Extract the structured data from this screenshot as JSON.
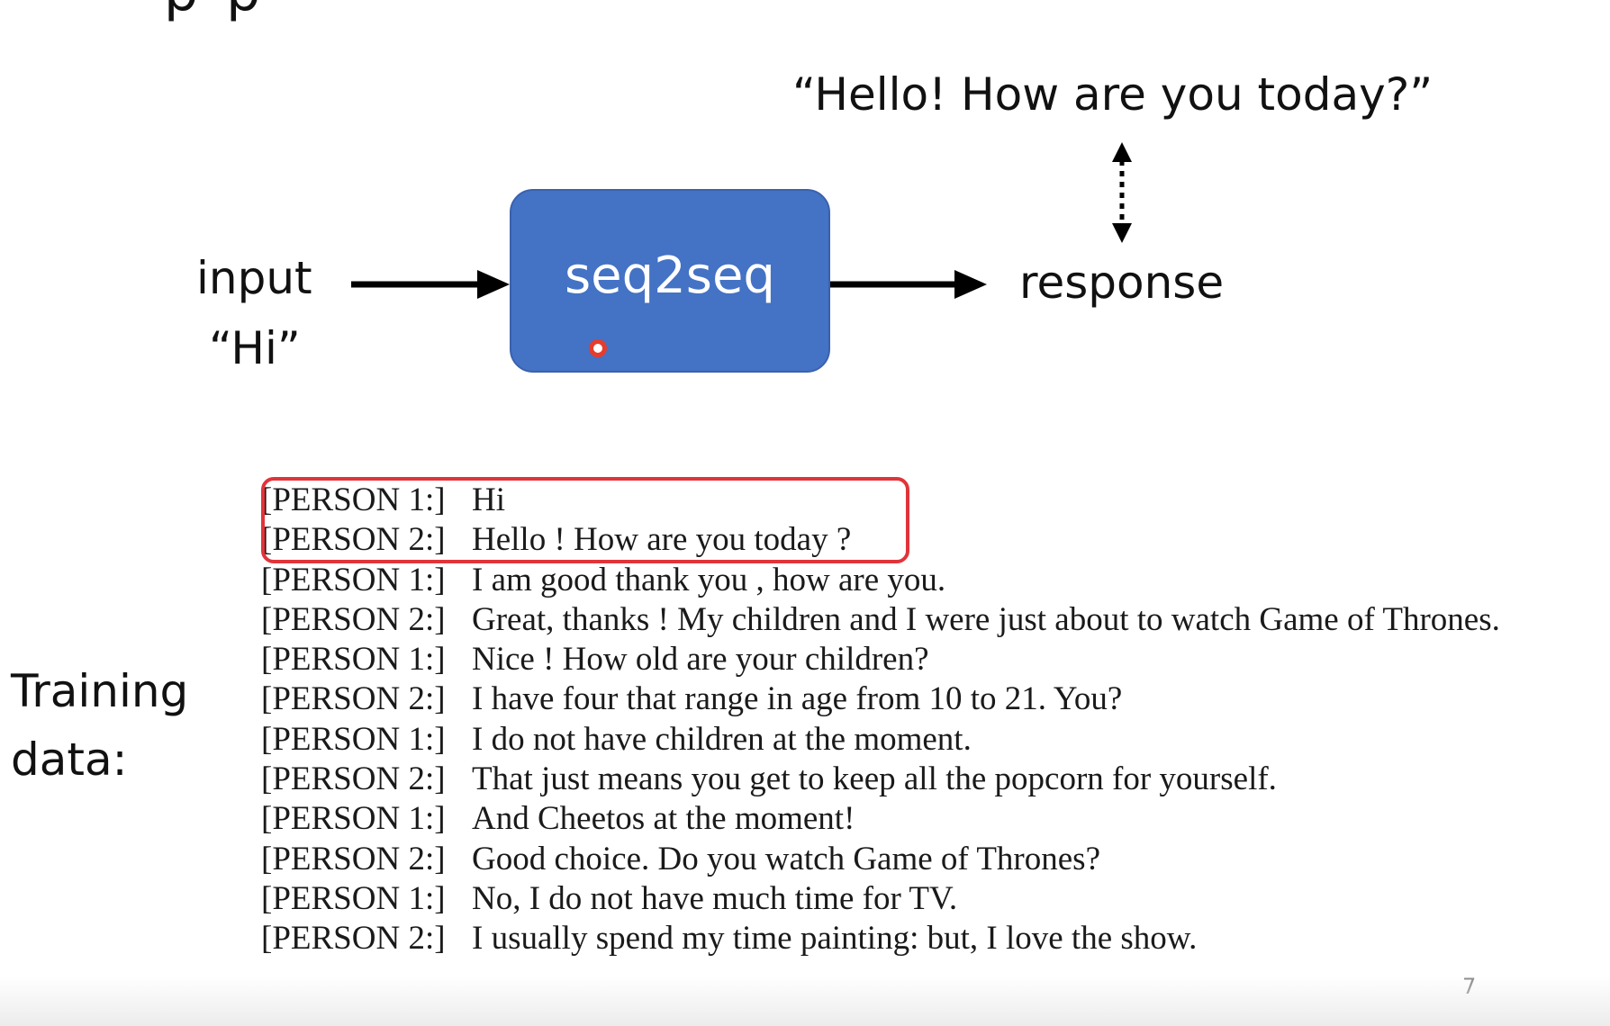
{
  "slide": {
    "title_fragment": "p   p",
    "page_number": "7"
  },
  "diagram": {
    "target_text": "“Hello! How are you today?”",
    "input_label": "input",
    "input_example": "“Hi”",
    "model_label": "seq2seq",
    "response_label": "response"
  },
  "training": {
    "label_line1": "Training",
    "label_line2": "data:",
    "lines": [
      {
        "speaker": "[PERSON 1:]",
        "text": "Hi"
      },
      {
        "speaker": "[PERSON 2:]",
        "text": "Hello ! How are you today ?"
      },
      {
        "speaker": "[PERSON 1:]",
        "text": "I am good thank you , how are you."
      },
      {
        "speaker": "[PERSON 2:]",
        "text": "Great, thanks ! My children and I were just about to watch Game of Thrones."
      },
      {
        "speaker": "[PERSON 1:]",
        "text": "Nice ! How old are your children?"
      },
      {
        "speaker": "[PERSON 2:]",
        "text": "I have four that range in age from 10 to 21. You?"
      },
      {
        "speaker": "[PERSON 1:]",
        "text": "I do not have children at the moment."
      },
      {
        "speaker": "[PERSON 2:]",
        "text": "That just means you get to keep all the popcorn for yourself."
      },
      {
        "speaker": "[PERSON 1:]",
        "text": "And Cheetos at the moment!"
      },
      {
        "speaker": "[PERSON 2:]",
        "text": "Good choice. Do you watch Game of Thrones?"
      },
      {
        "speaker": "[PERSON 1:]",
        "text": "No, I do not have much time for TV."
      },
      {
        "speaker": "[PERSON 2:]",
        "text": "I usually spend my time painting: but, I love the show."
      }
    ]
  },
  "colors": {
    "model_box": "#4472c4",
    "highlight": "#e0343a",
    "cursor": "#e53c2e"
  }
}
